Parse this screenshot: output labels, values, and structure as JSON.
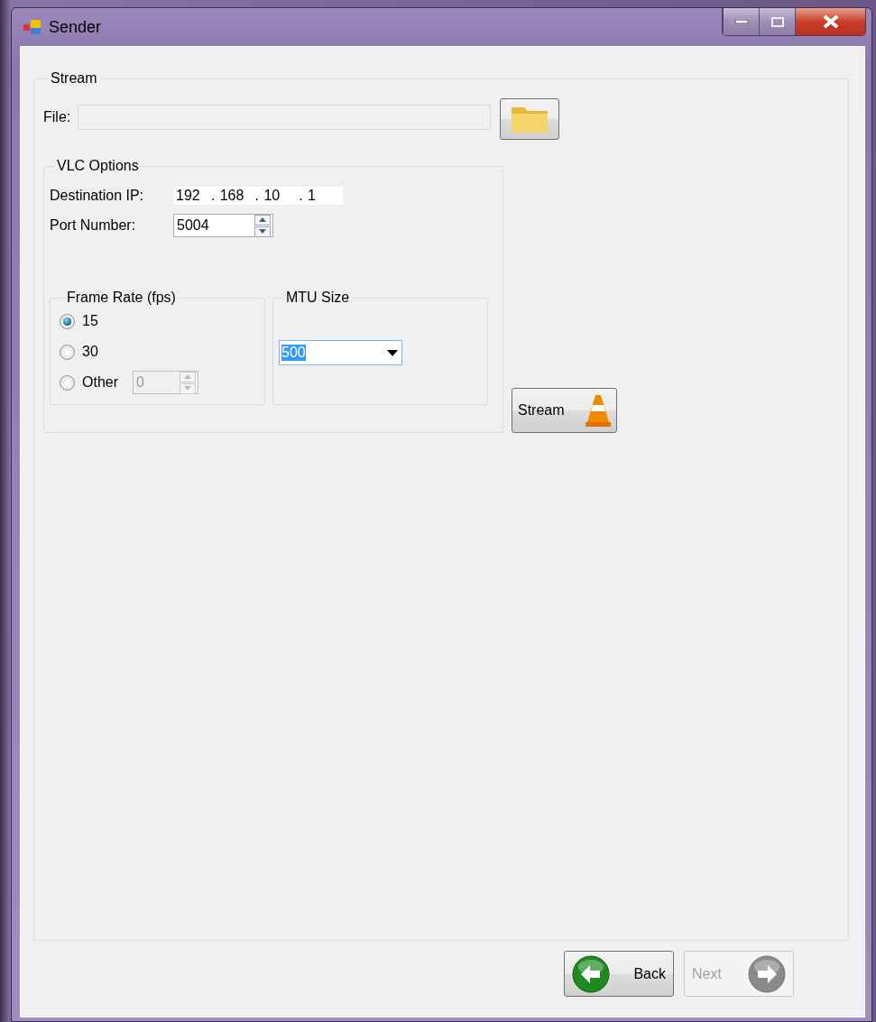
{
  "window": {
    "title": "Sender"
  },
  "stream_group": {
    "title": "Stream",
    "file": {
      "label": "File:",
      "disabled": true
    }
  },
  "vlc_options": {
    "title": "VLC Options",
    "destination_ip": {
      "label": "Destination IP:",
      "octets": [
        "192",
        "168",
        "10",
        "1"
      ],
      "separator": "."
    },
    "port": {
      "label": "Port Number:",
      "value": "5004"
    },
    "frame_rate": {
      "title": "Frame Rate (fps)",
      "options": [
        {
          "label": "15",
          "selected": true
        },
        {
          "label": "30",
          "selected": false
        },
        {
          "label": "Other",
          "selected": false
        }
      ],
      "other_value": {
        "value": "0",
        "disabled": true
      }
    },
    "mtu": {
      "title": "MTU Size",
      "value": "500",
      "highlighted": true
    }
  },
  "stream_button": {
    "label": "Stream"
  },
  "buttons": [
    {
      "kind": "back",
      "label": "Back",
      "disabled": false
    },
    {
      "kind": "next",
      "label": "Next",
      "disabled": true
    }
  ]
}
